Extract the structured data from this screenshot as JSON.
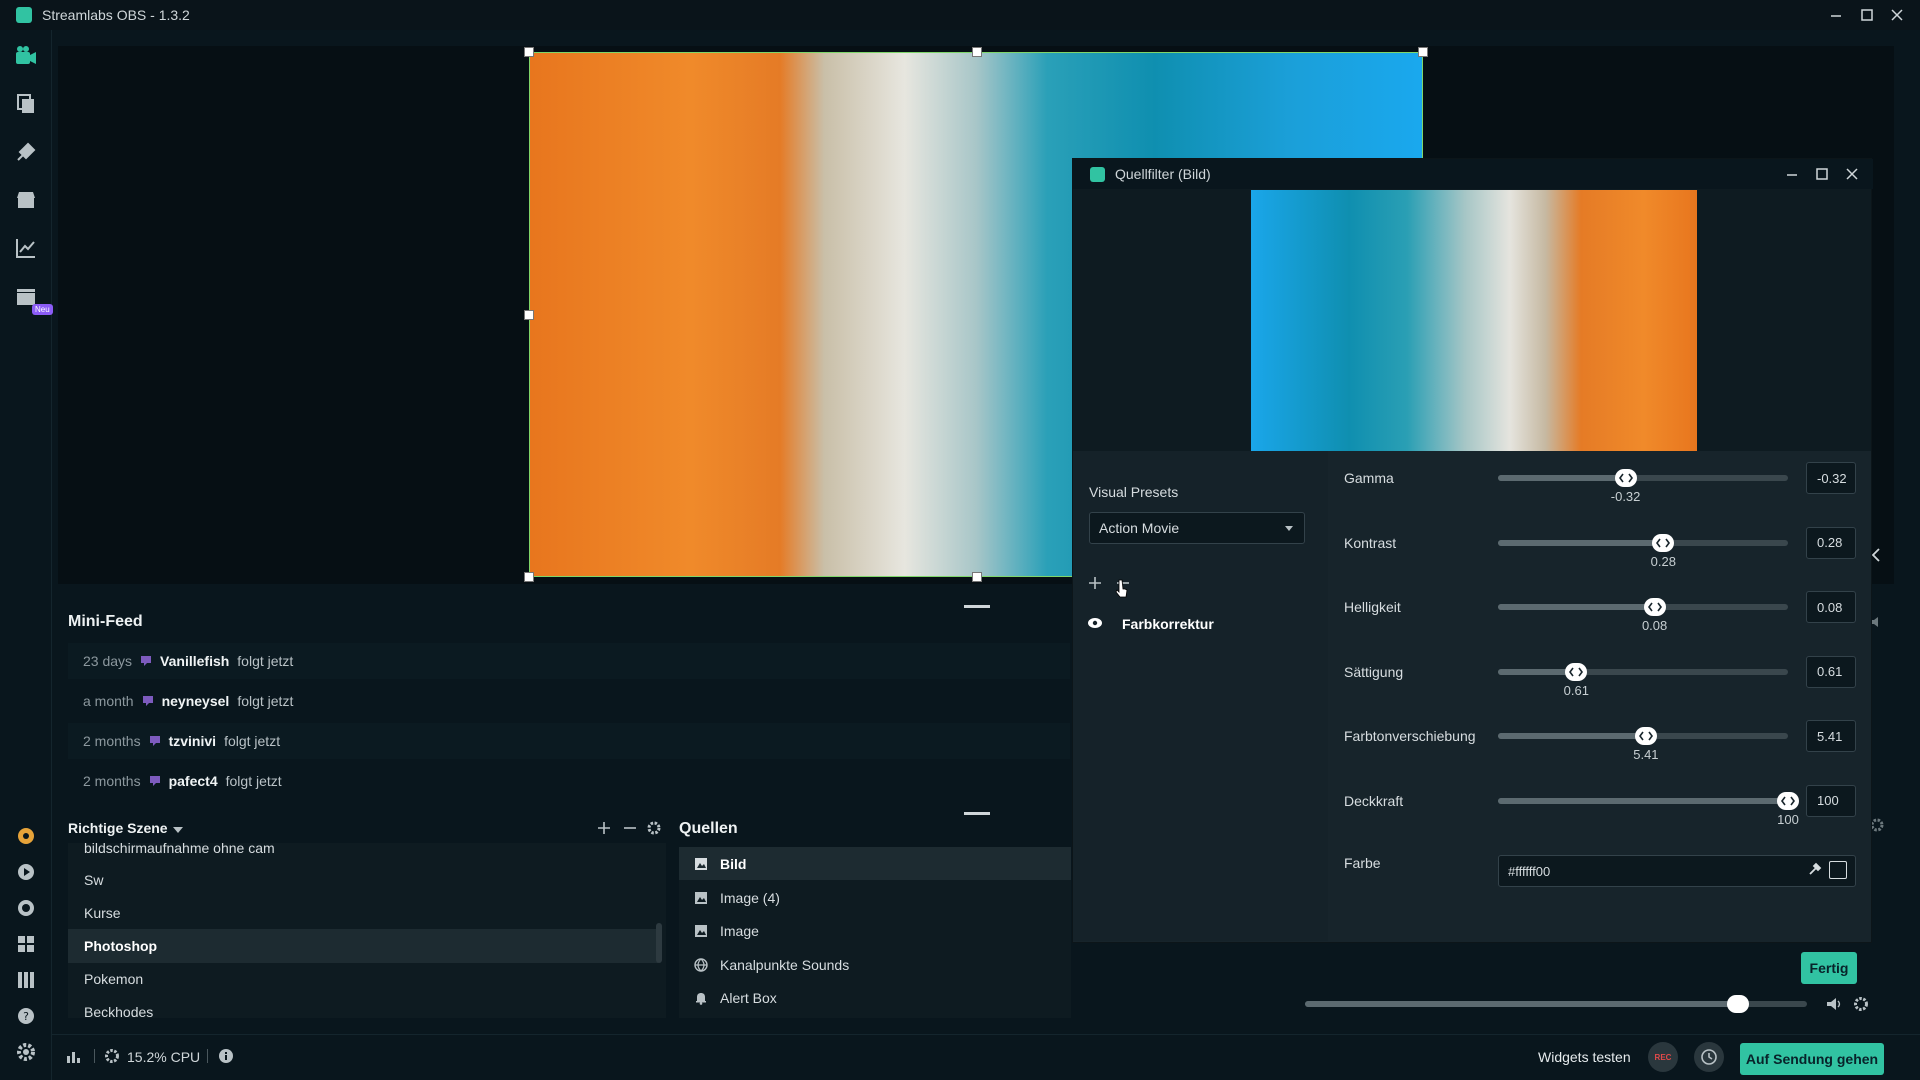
{
  "window": {
    "title": "Streamlabs OBS - 1.3.2"
  },
  "nav": {
    "new_badge": "Neu"
  },
  "minifeed": {
    "title": "Mini-Feed",
    "items": [
      {
        "time": "23 days",
        "name": "Vanillefish",
        "action": "folgt jetzt"
      },
      {
        "time": "a month",
        "name": "neyneysel",
        "action": "folgt jetzt"
      },
      {
        "time": "2 months",
        "name": "tzvinivi",
        "action": "folgt jetzt"
      },
      {
        "time": "2 months",
        "name": "pafect4",
        "action": "folgt jetzt"
      }
    ]
  },
  "scenes": {
    "title": "Richtige Szene",
    "items": [
      {
        "label": "bildschirmaufnahme ohne cam"
      },
      {
        "label": "Sw"
      },
      {
        "label": "Kurse"
      },
      {
        "label": "Photoshop",
        "active": true
      },
      {
        "label": "Pokemon"
      },
      {
        "label": "Beckhodes"
      }
    ]
  },
  "sources": {
    "title": "Quellen",
    "items": [
      {
        "label": "Bild",
        "icon": "image-icon",
        "active": true
      },
      {
        "label": "Image (4)",
        "icon": "image-icon"
      },
      {
        "label": "Image",
        "icon": "image-icon"
      },
      {
        "label": "Kanalpunkte Sounds",
        "icon": "globe-icon"
      },
      {
        "label": "Alert Box",
        "icon": "bell-icon"
      }
    ]
  },
  "statusbar": {
    "cpu": "15.2% CPU",
    "widgets_test": "Widgets testen",
    "rec": "REC",
    "go_live": "Auf Sendung gehen"
  },
  "dialog": {
    "title": "Quellfilter (Bild)",
    "visual_presets_label": "Visual Presets",
    "preset_value": "Action Movie",
    "filter_name": "Farbkorrektur",
    "sliders": [
      {
        "label": "Gamma",
        "value": "-0.32",
        "fraction": 0.44
      },
      {
        "label": "Kontrast",
        "value": "0.28",
        "fraction": 0.57
      },
      {
        "label": "Helligkeit",
        "value": "0.08",
        "fraction": 0.54
      },
      {
        "label": "Sättigung",
        "value": "0.61",
        "fraction": 0.27
      },
      {
        "label": "Farbtonverschiebung",
        "value": "5.41",
        "fraction": 0.51
      },
      {
        "label": "Deckkraft",
        "value": "100",
        "fraction": 1.0
      }
    ],
    "color_label": "Farbe",
    "color_value": "#ffffff00",
    "done": "Fertig"
  },
  "colors": {
    "accent": "#31c3a2",
    "background": "#09161d",
    "panel": "#17242b"
  }
}
